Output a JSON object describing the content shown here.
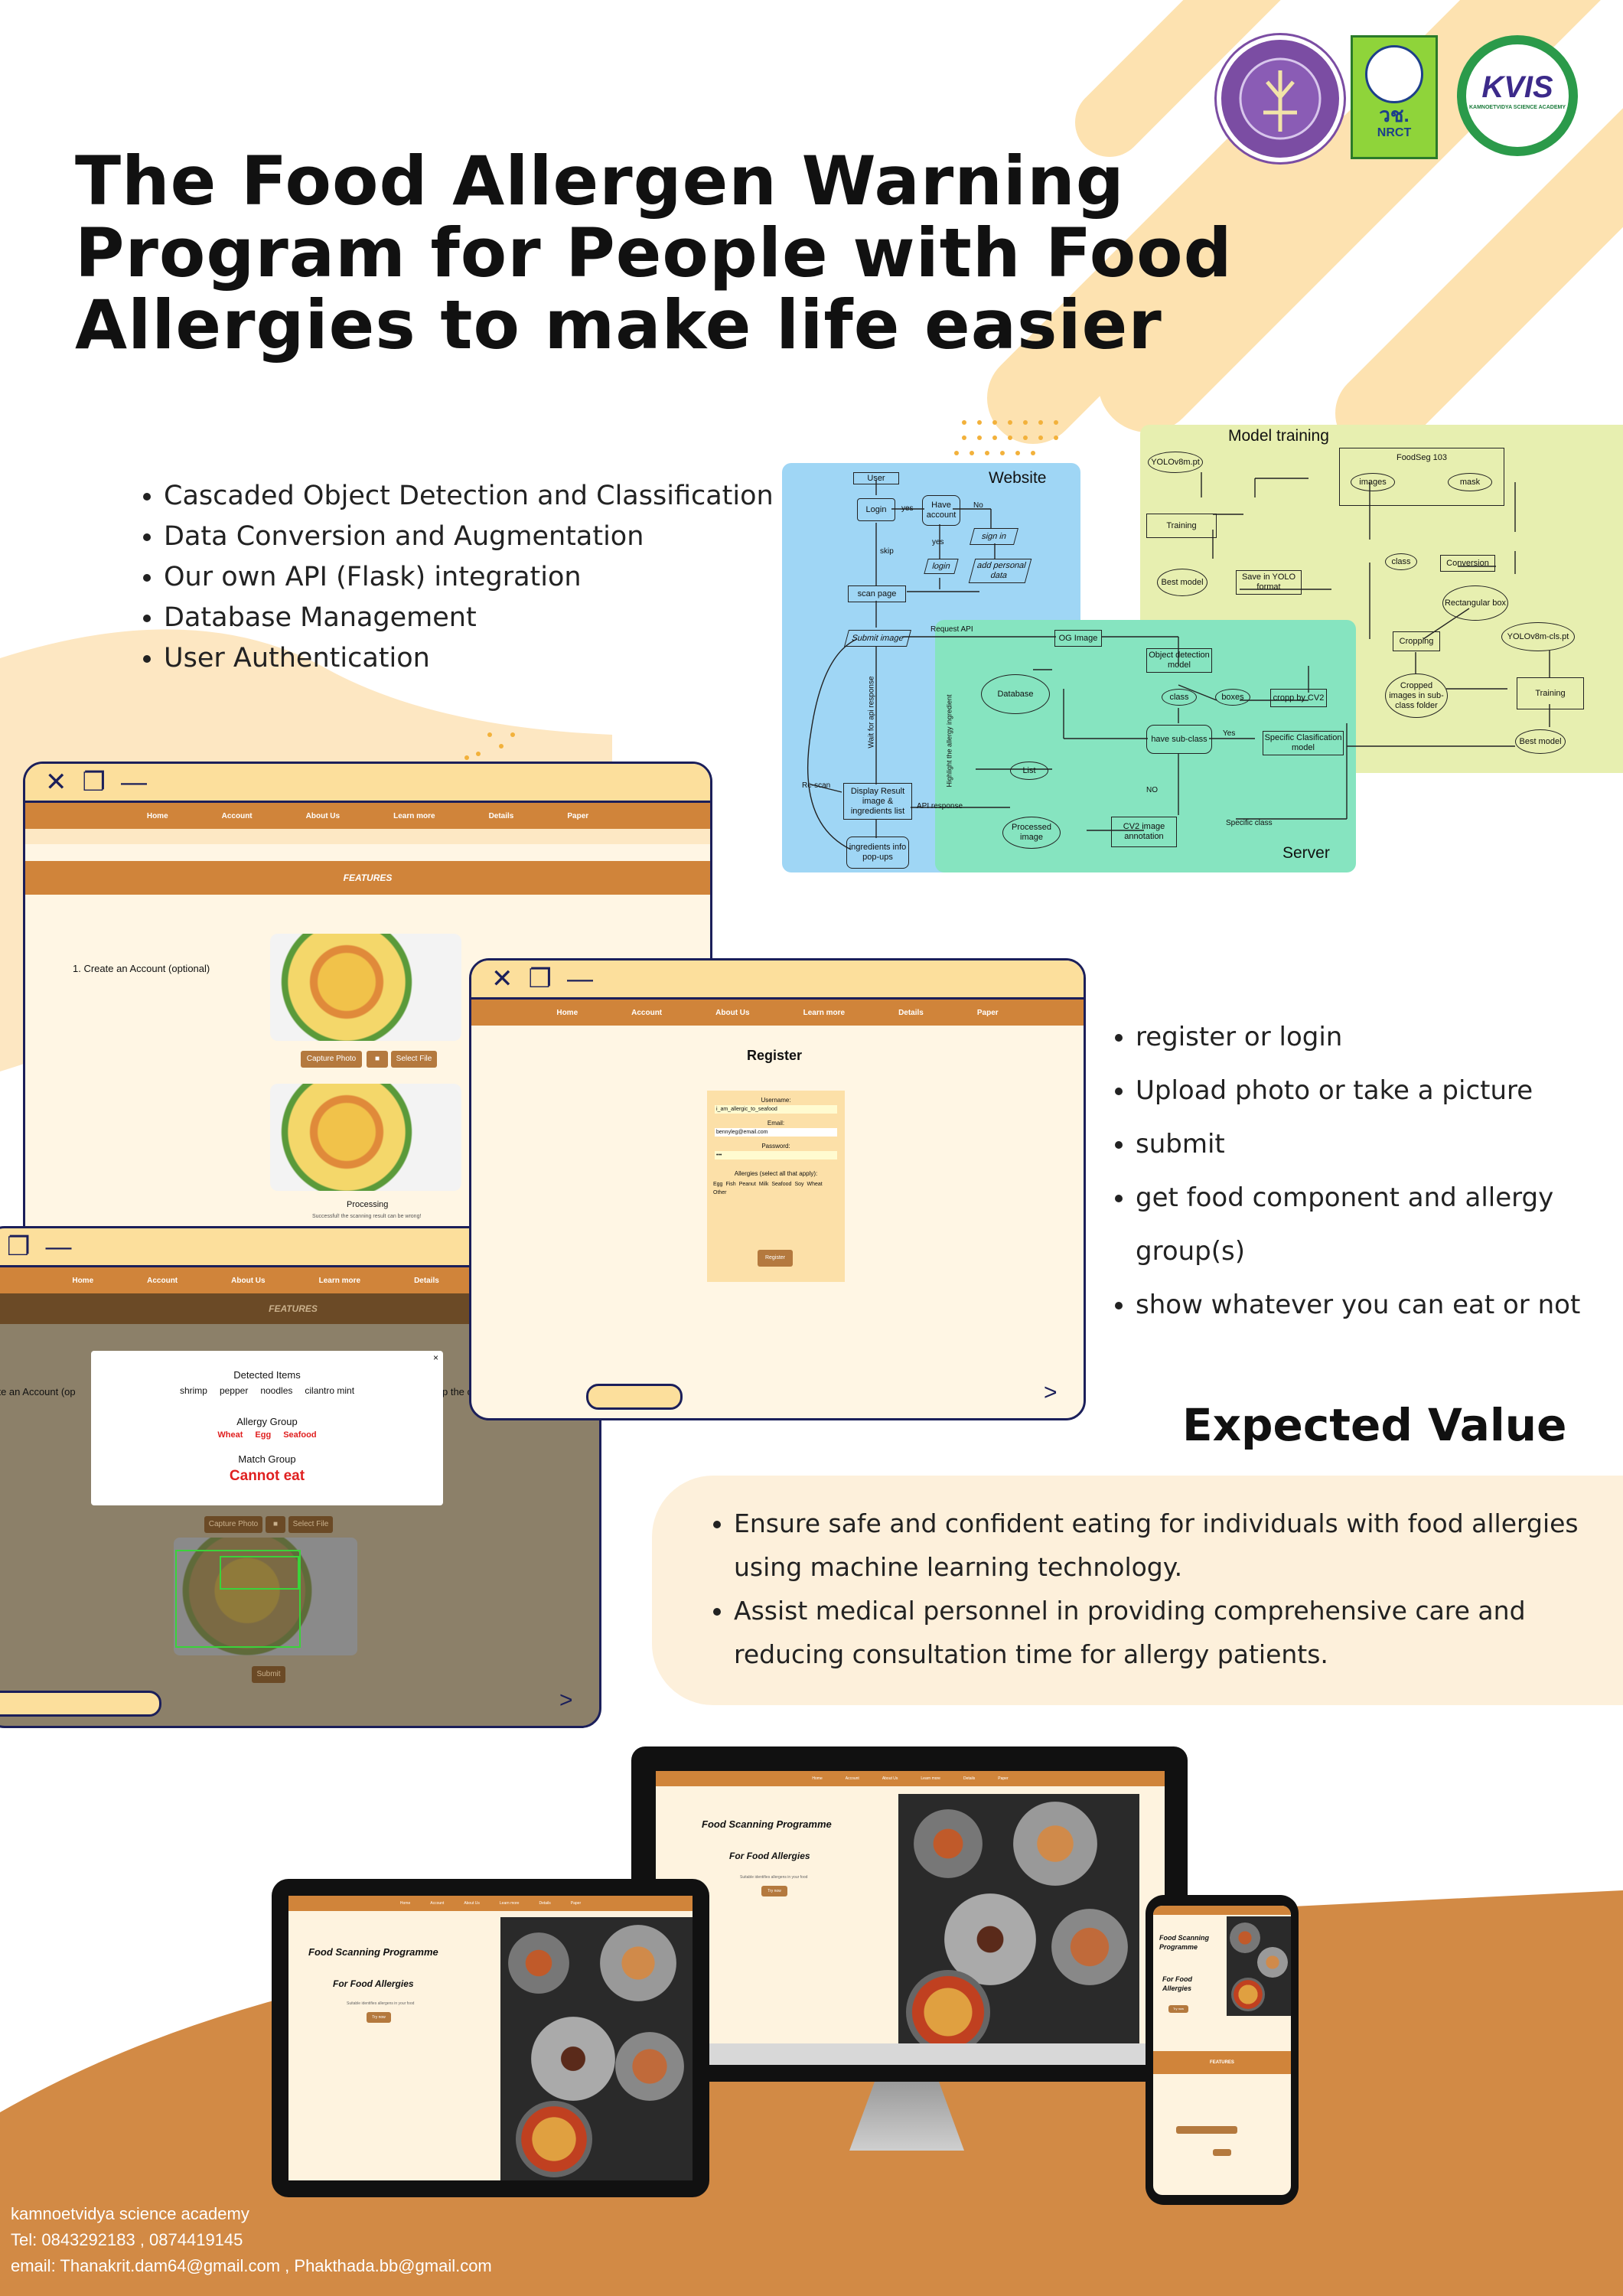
{
  "title_lines": [
    "The Food Allergen Warning",
    "Program for People with Food",
    "Allergies to make life easier"
  ],
  "logos": {
    "logo1": "Science Classroom seal",
    "nrct_text": "วช.",
    "nrct_sub": "NRCT",
    "kvis_text": "KVIS",
    "kvis_sub": "KAMNOETVIDYA SCIENCE ACADEMY"
  },
  "tech_list": [
    "Cascaded Object Detection and Classification",
    "Data Conversion and Augmentation",
    "Our own API (Flask) integration",
    "Database Management",
    "User Authentication"
  ],
  "diagram": {
    "website_label": "Website",
    "server_label": "Server",
    "model_label": "Model training",
    "website_nodes": {
      "user": "User",
      "login": "Login",
      "have_account": "Have account",
      "yes1": "yes",
      "no1": "No",
      "sign_in": "sign in",
      "yes2": "yes",
      "login2": "login",
      "add_personal": "add personal data",
      "skip": "skip",
      "scan_page": "scan page",
      "submit_image": "Submit image",
      "wait": "Wait for api response",
      "rescan": "Re-scan",
      "display": "Display Result image & ingredients list",
      "popups": "ingredients info pop-ups"
    },
    "server_nodes": {
      "request_api": "Request API",
      "og_image": "OG Image",
      "database": "Database",
      "highlight": "Highlight the allergy ingredient",
      "object_detection": "Object detection model",
      "class1": "class",
      "boxes": "boxes",
      "cropp": "cropp by CV2",
      "sub_class": "have sub-class",
      "yes3": "Yes",
      "specific_model": "Specific Clasification model",
      "list": "List",
      "no2": "NO",
      "api_response": "API response",
      "processed": "Processed image",
      "cv2_annotation": "CV2 image annotation",
      "specific_class": "Specific class"
    },
    "model_nodes": {
      "yolo": "YOLOv8m.pt",
      "foodseg": "FoodSeg 103",
      "images": "images",
      "mask": "mask",
      "training": "Training",
      "class2": "class",
      "conversion": "Conversion",
      "best_model": "Best model",
      "save_yolo": "Save in YOLO format",
      "rect_box": "Rectangular box",
      "cropping": "Cropping",
      "yolo_cls": "YOLOv8m-cls.pt",
      "cropped": "Cropped images in sub-class folder",
      "training2": "Training",
      "best_model2": "Best model"
    }
  },
  "nav_items": [
    "Home",
    "Account",
    "About Us",
    "Learn more",
    "Details",
    "Paper"
  ],
  "window1": {
    "features": "FEATURES",
    "step": "1. Create an Account (optional)",
    "capture": "Capture Photo",
    "select": "Select File",
    "processing": "Processing",
    "processing_note": "Successful! the scanning result can be wrong!"
  },
  "window2": {
    "heading": "Register",
    "username_label": "Username:",
    "username_value": "i_am_allergic_to_seafood",
    "email_label": "Email:",
    "email_value": "bennyleg@email.com",
    "password_label": "Password:",
    "password_value": "•••",
    "allergies_label": "Allergies (select all that apply):",
    "allergies": [
      "Egg",
      "Fish",
      "Peanut",
      "Milk",
      "Seafood",
      "Soy",
      "Wheat",
      "Other"
    ],
    "register": "Register"
  },
  "window3": {
    "features": "FEATURES",
    "left_text": "eate an Account (op",
    "right_text": "p the capture button",
    "detected_title": "Detected Items",
    "detected": [
      "shrimp",
      "pepper",
      "noodles",
      "cilantro mint"
    ],
    "allergy_title": "Allergy Group",
    "allergy": [
      "Wheat",
      "Egg",
      "Seafood"
    ],
    "match_title": "Match Group",
    "verdict": "Cannot eat",
    "close": "×",
    "capture": "Capture Photo",
    "select": "Select File",
    "submit": "Submit"
  },
  "steps_list": [
    "register or login",
    "Upload photo or take a picture",
    "submit",
    "get food component and allergy group(s)",
    "show whatever you can eat or not"
  ],
  "expected": {
    "title": "Expected Value",
    "items": [
      "Ensure safe and confident eating for individuals with food allergies using machine learning technology.",
      "Assist medical personnel in providing comprehensive care and reducing consultation time for allergy patients."
    ]
  },
  "devices": {
    "heading1": "Food Scanning Programme",
    "heading2": "For Food Allergies",
    "sub": "Suitable identifies allergens in your food",
    "button": "Try now",
    "phone_h1": "Food Scanning Programme",
    "phone_h2": "For Food Allergies",
    "phone_feat": "FEATURES"
  },
  "footer": [
    "kamnoetvidya science academy",
    "Tel: 0843292183 , 0874419145",
    "email: Thanakrit.dam64@gmail.com , Phakthada.bb@gmail.com"
  ],
  "colors": {
    "accent": "#d0843a",
    "cream": "#fcdf9c",
    "navy": "#1b1f5a",
    "website_bg": "#9fd6f5",
    "server_bg": "#86e4c0",
    "model_bg": "#e7efb0",
    "danger": "#e02020"
  }
}
